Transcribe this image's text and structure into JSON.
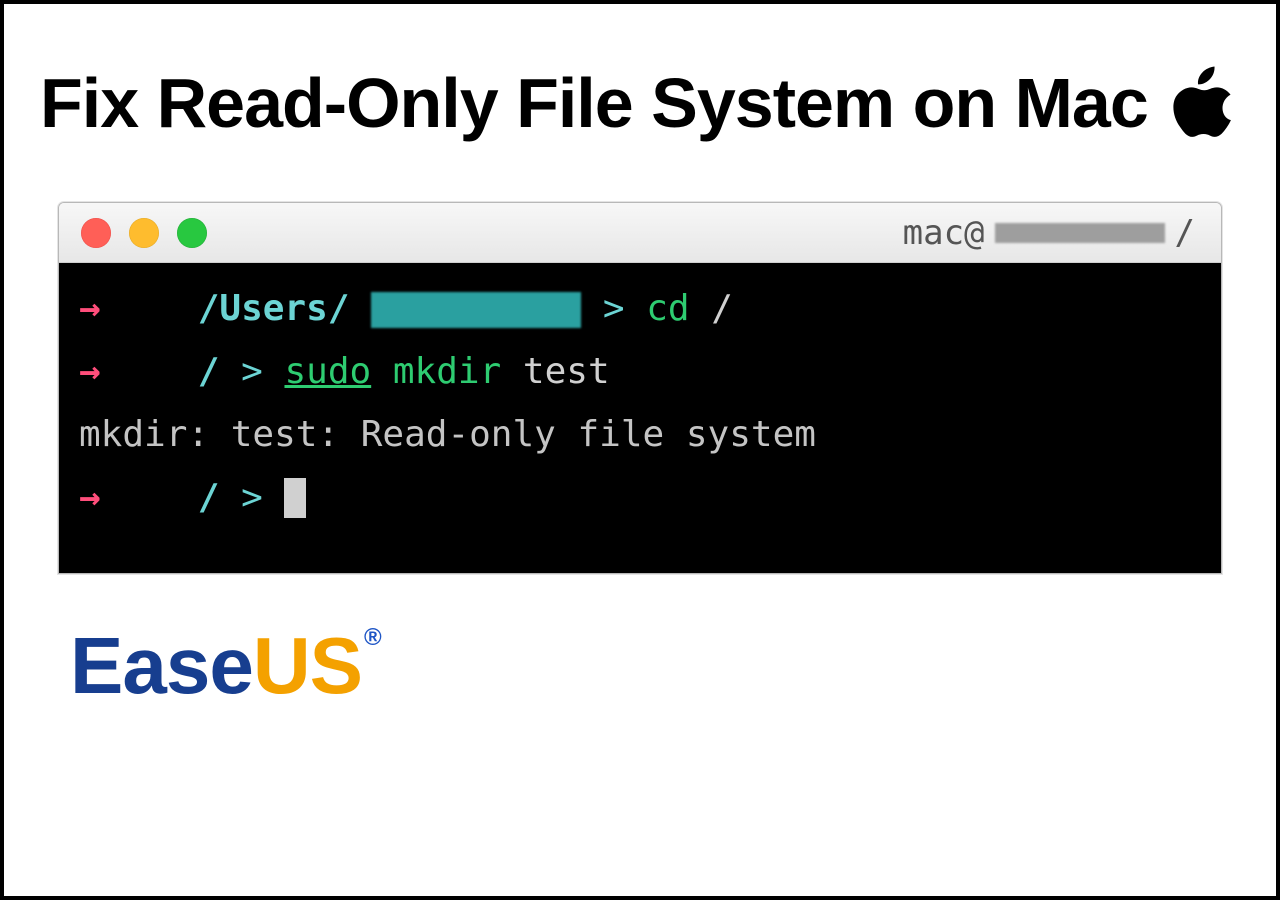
{
  "headline": {
    "text": "Fix Read-Only File System on Mac"
  },
  "terminal": {
    "title_prefix": "mac@",
    "title_suffix": " /",
    "lines": {
      "l1_path": "/Users/",
      "l1_gt": " > ",
      "l1_cmd": "cd",
      "l1_arg": " /",
      "l2_path": "/",
      "l2_gt": " > ",
      "l2_sudo": "sudo",
      "l2_mkdir": " mkdir",
      "l2_arg": " test",
      "l3_msg": "mkdir: test: Read-only file system",
      "l4_path": "/",
      "l4_gt": " > "
    }
  },
  "brand": {
    "part1": "Ease",
    "part2": "US",
    "reg": "®"
  }
}
